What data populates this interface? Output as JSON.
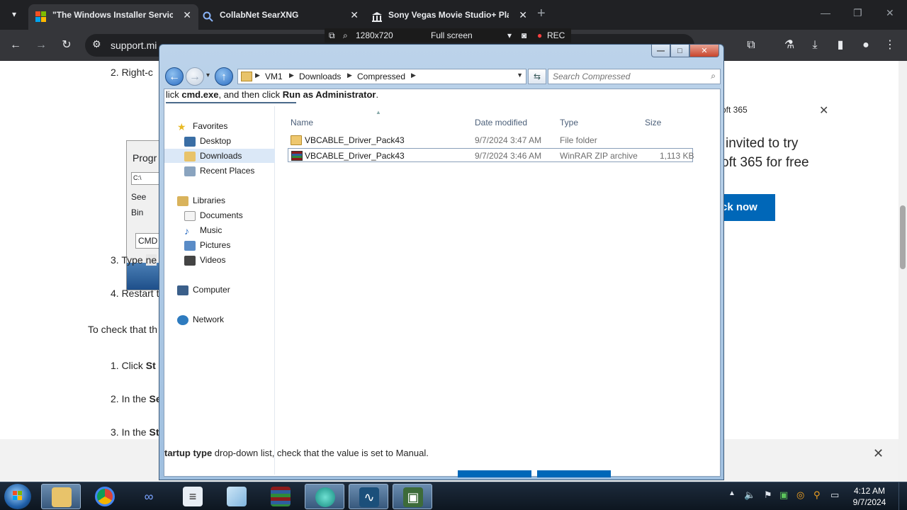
{
  "browser": {
    "tabs": [
      {
        "title": "\"The Windows Installer Servic",
        "active": true
      },
      {
        "title": "CollabNet SearXNG",
        "active": false
      },
      {
        "title": "Sony Vegas Movie Studio+ Pla",
        "active": false
      }
    ],
    "url": "support.mi",
    "new_tab": "+"
  },
  "recorder": {
    "size": "1280x720",
    "mode": "Full screen",
    "rec": "REC"
  },
  "page": {
    "step2": "2.  Right-c",
    "step3": "3.  Type",
    "step3_code": "ne",
    "step4": "4.  Restart t",
    "check": "To check that th",
    "click_step": "1.  Click",
    "click_bold": "St",
    "in_the_1": "2.  In the",
    "in_the_1_bold": "Se",
    "in_the_2": "3.  In the",
    "in_the_2_bold": "St",
    "thumb_label_1": "Progr",
    "thumb_label_2": "See",
    "thumb_label_3": "Bin",
    "thumb_input": "CMD",
    "ms_header": "oft 365",
    "ms_line1": "invited to try",
    "ms_line2": "oft 365 for free",
    "ms_button": "ck now",
    "cookie_text_bold": "tartup type",
    "cookie_text": " drop-down list, check that the value is set to Manual.",
    "overlap_prefix": "lick ",
    "overlap_bold1": "cmd.exe",
    "overlap_mid": ", and then click ",
    "overlap_bold2": "Run as Administrator",
    "overlap_end": "."
  },
  "explorer": {
    "breadcrumbs": [
      "VM1",
      "Downloads",
      "Compressed"
    ],
    "search_placeholder": "Search Compressed",
    "nav": {
      "favorites": "Favorites",
      "desktop": "Desktop",
      "downloads": "Downloads",
      "recent": "Recent Places",
      "libraries": "Libraries",
      "documents": "Documents",
      "music": "Music",
      "pictures": "Pictures",
      "videos": "Videos",
      "computer": "Computer",
      "network": "Network"
    },
    "columns": {
      "name": "Name",
      "date": "Date modified",
      "type": "Type",
      "size": "Size"
    },
    "files": [
      {
        "name": "VBCABLE_Driver_Pack43",
        "date": "9/7/2024 3:47 AM",
        "type": "File folder",
        "size": ""
      },
      {
        "name": "VBCABLE_Driver_Pack43",
        "date": "9/7/2024 3:46 AM",
        "type": "WinRAR ZIP archive",
        "size": "1,113 KB"
      }
    ]
  },
  "taskbar": {
    "time": "4:12 AM",
    "date": "9/7/2024"
  }
}
